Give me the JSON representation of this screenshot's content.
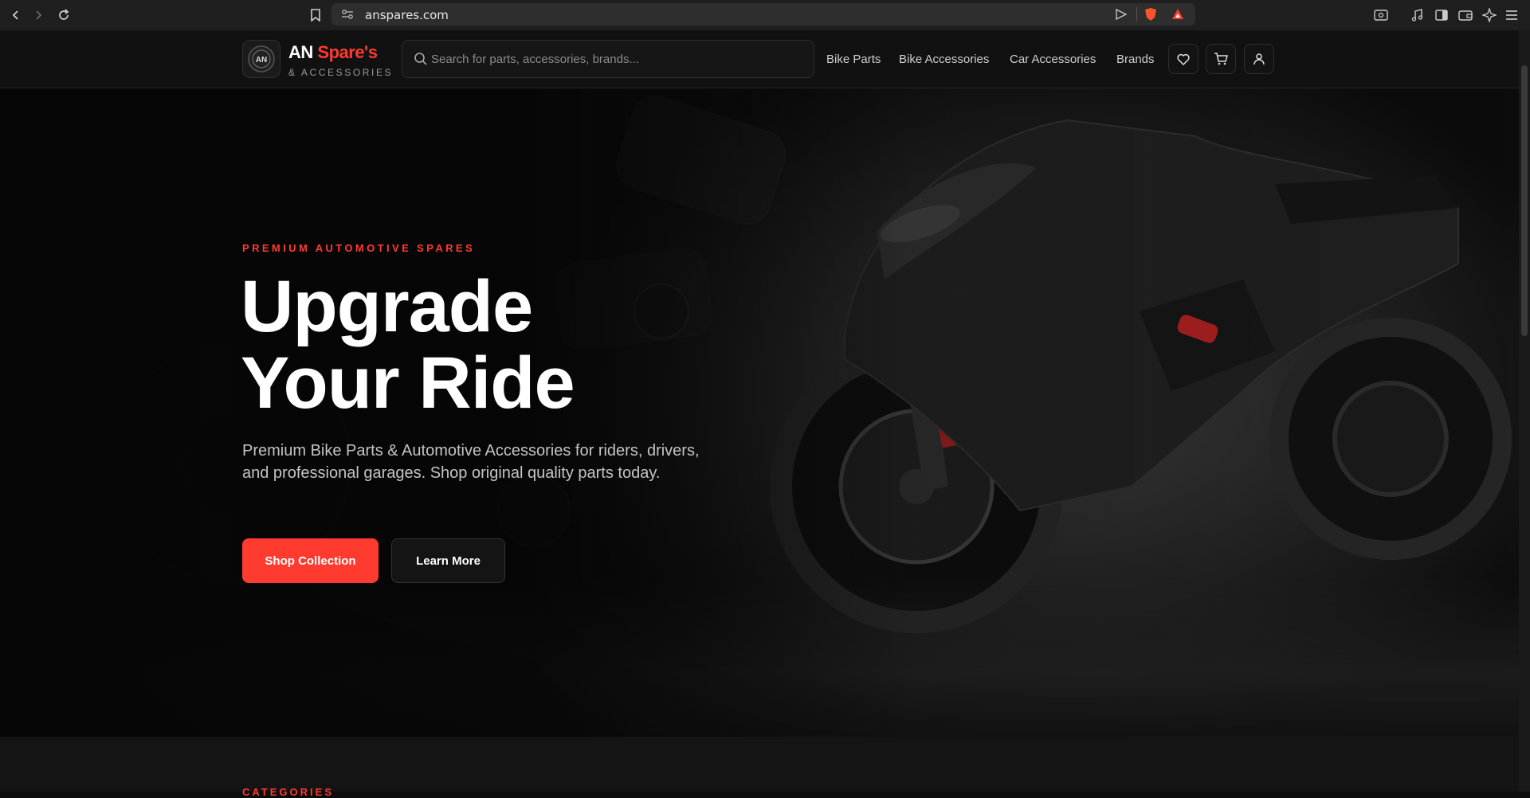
{
  "browser": {
    "url": "anspares.com"
  },
  "header": {
    "logo_prefix": "AN",
    "logo_highlight": "Spare's",
    "logo_sub": "& ACCESSORIES",
    "logo_badge_text": "AN",
    "search_placeholder": "Search for parts, accessories, brands...",
    "nav": [
      "Bike Parts",
      "Bike Accessories",
      "Car Accessories",
      "Brands"
    ]
  },
  "hero": {
    "eyebrow": "PREMIUM AUTOMOTIVE SPARES",
    "title_line1": "Upgrade",
    "title_line2": "Your Ride",
    "description": "Premium Bike Parts & Automotive Accessories for riders, drivers, and professional garages. Shop original quality parts today.",
    "primary_cta": "Shop Collection",
    "secondary_cta": "Learn More"
  },
  "next_section": {
    "label": "CATEGORIES"
  },
  "colors": {
    "accent": "#ff3b30",
    "background": "#0d0d0d"
  }
}
